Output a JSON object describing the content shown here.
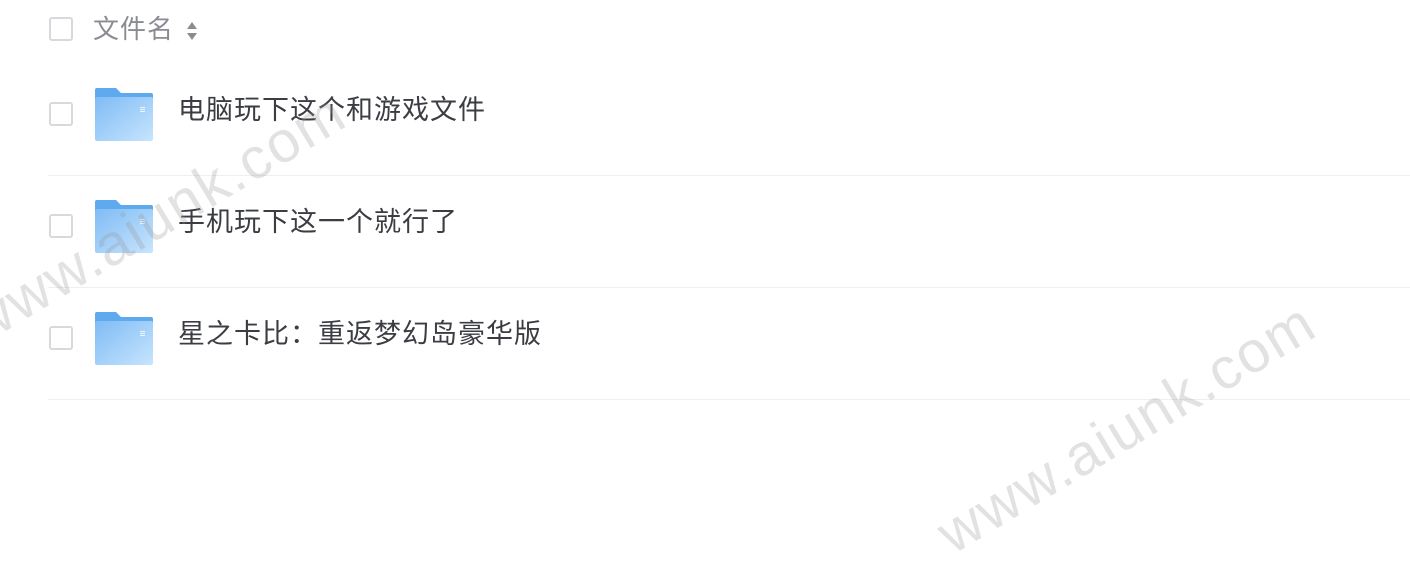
{
  "header": {
    "column_label": "文件名",
    "sort_icon": "sort-icon"
  },
  "files": [
    {
      "name": "电脑玩下这个和游戏文件",
      "icon": "folder-icon"
    },
    {
      "name": "手机玩下这一个就行了",
      "icon": "folder-icon"
    },
    {
      "name": "星之卡比：重返梦幻岛豪华版",
      "icon": "folder-icon"
    }
  ],
  "watermark": "www.aiunk.com",
  "colors": {
    "folder_light": "#b8dcfb",
    "folder_dark": "#5fa9ee",
    "text": "#3b3d42",
    "header_text": "#8a8c92",
    "divider": "#eeeff1"
  }
}
